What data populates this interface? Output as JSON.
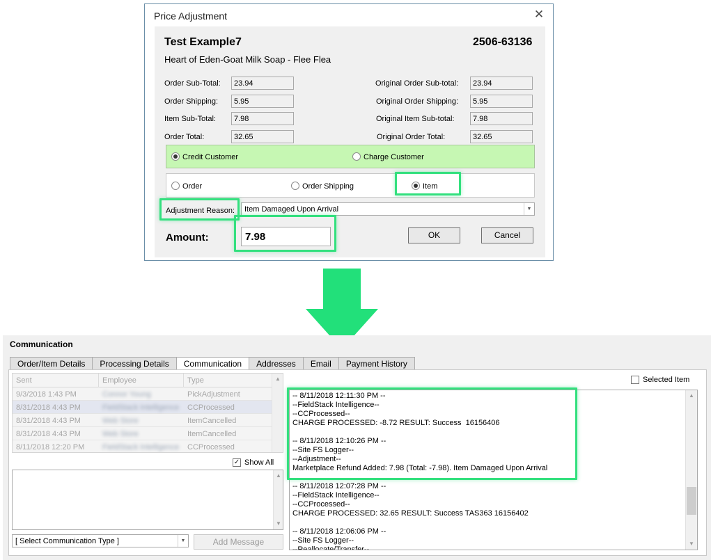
{
  "dialog": {
    "title": "Price Adjustment",
    "close_glyph": "✕",
    "customer_name": "Test Example7",
    "order_number": "2506-63136",
    "product": "Heart of Eden-Goat Milk Soap - Flee Flea",
    "fields_left": [
      {
        "label": "Order Sub-Total:",
        "value": "23.94"
      },
      {
        "label": "Order Shipping:",
        "value": "5.95"
      },
      {
        "label": "Item Sub-Total:",
        "value": "7.98"
      },
      {
        "label": "Order Total:",
        "value": "32.65"
      }
    ],
    "fields_right": [
      {
        "label": "Original Order Sub-total:",
        "value": "23.94"
      },
      {
        "label": "Original Order Shipping:",
        "value": "5.95"
      },
      {
        "label": "Original Item Sub-total:",
        "value": "7.98"
      },
      {
        "label": "Original Order Total:",
        "value": "32.65"
      }
    ],
    "credit_options": [
      {
        "label": "Credit Customer",
        "selected": true
      },
      {
        "label": "Charge Customer",
        "selected": false
      }
    ],
    "scope_options": [
      {
        "label": "Order",
        "selected": false
      },
      {
        "label": "Order Shipping",
        "selected": false
      },
      {
        "label": "Item",
        "selected": true
      }
    ],
    "reason_label": "Adjustment Reason:",
    "reason_value": "Item Damaged Upon Arrival",
    "amount_label": "Amount:",
    "amount_value": "7.98",
    "ok_label": "OK",
    "cancel_label": "Cancel"
  },
  "communication": {
    "title": "Communication",
    "tabs": [
      {
        "label": "Order/Item Details",
        "active": false
      },
      {
        "label": "Processing Details",
        "active": false
      },
      {
        "label": "Communication",
        "active": true
      },
      {
        "label": "Addresses",
        "active": false
      },
      {
        "label": "Email",
        "active": false
      },
      {
        "label": "Payment History",
        "active": false
      }
    ],
    "grid_headers": [
      "Sent",
      "Employee",
      "Type"
    ],
    "grid_rows": [
      {
        "sent": "9/3/2018 1:43 PM",
        "employee": "Connor Young",
        "type": "PickAdjustment"
      },
      {
        "sent": "8/31/2018 4:43 PM",
        "employee": "FieldStack Intelligence",
        "type": "CCProcessed"
      },
      {
        "sent": "8/31/2018 4:43 PM",
        "employee": "Web Store",
        "type": "ItemCancelled"
      },
      {
        "sent": "8/31/2018 4:43 PM",
        "employee": "Web Store",
        "type": "ItemCancelled"
      },
      {
        "sent": "8/11/2018 12:20 PM",
        "employee": "FieldStack Intelligence",
        "type": "CCProcessed"
      }
    ],
    "show_all_label": "Show All",
    "show_all_checked": true,
    "select_type_label": "[ Select Communication Type ]",
    "add_message_label": "Add Message",
    "selected_item_label": "Selected Item",
    "selected_item_checked": false,
    "log_lines": [
      "-- 8/11/2018 12:11:30 PM --",
      "--FieldStack Intelligence--",
      "--CCProcessed--",
      "CHARGE PROCESSED: -8.72 RESULT: Success  16156406",
      "",
      "-- 8/11/2018 12:10:26 PM --",
      "--Site FS Logger--",
      "--Adjustment--",
      "Marketplace Refund Added: 7.98 (Total: -7.98). Item Damaged Upon Arrival",
      "",
      "-- 8/11/2018 12:07:28 PM --",
      "--FieldStack Intelligence--",
      "--CCProcessed--",
      "CHARGE PROCESSED: 32.65 RESULT: Success TAS363 16156402",
      "",
      "-- 8/11/2018 12:06:06 PM --",
      "--Site FS Logger--",
      "--Reallocate/Transfer--"
    ]
  },
  "colors": {
    "highlight": "#33e07e",
    "credit_panel": "#c6f7b3",
    "arrow": "#22e07a"
  }
}
